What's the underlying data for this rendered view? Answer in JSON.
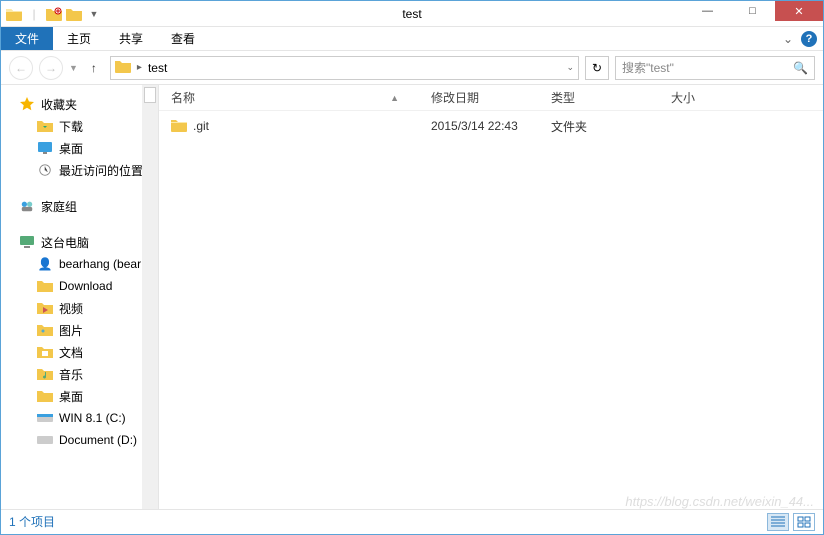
{
  "window": {
    "title": "test",
    "minimize": "—",
    "maximize": "□",
    "close": "✕"
  },
  "ribbon": {
    "file": "文件",
    "tabs": [
      "主页",
      "共享",
      "查看"
    ],
    "expand": "⌄"
  },
  "toolbar": {
    "path_label": "test",
    "search_placeholder": "搜索\"test\""
  },
  "sidebar": {
    "favorites": "收藏夹",
    "fav_items": [
      "下载",
      "桌面",
      "最近访问的位置"
    ],
    "homegroup": "家庭组",
    "computer": "这台电脑",
    "comp_items": [
      "bearhang (bear",
      "Download",
      "视频",
      "图片",
      "文档",
      "音乐",
      "桌面",
      "WIN 8.1 (C:)",
      "Document (D:)"
    ]
  },
  "columns": {
    "name": "名称",
    "date": "修改日期",
    "type": "类型",
    "size": "大小"
  },
  "files": [
    {
      "name": ".git",
      "date": "2015/3/14 22:43",
      "type": "文件夹"
    }
  ],
  "statusbar": {
    "count": "1 个项目"
  },
  "watermark": "https://blog.csdn.net/weixin_44..."
}
